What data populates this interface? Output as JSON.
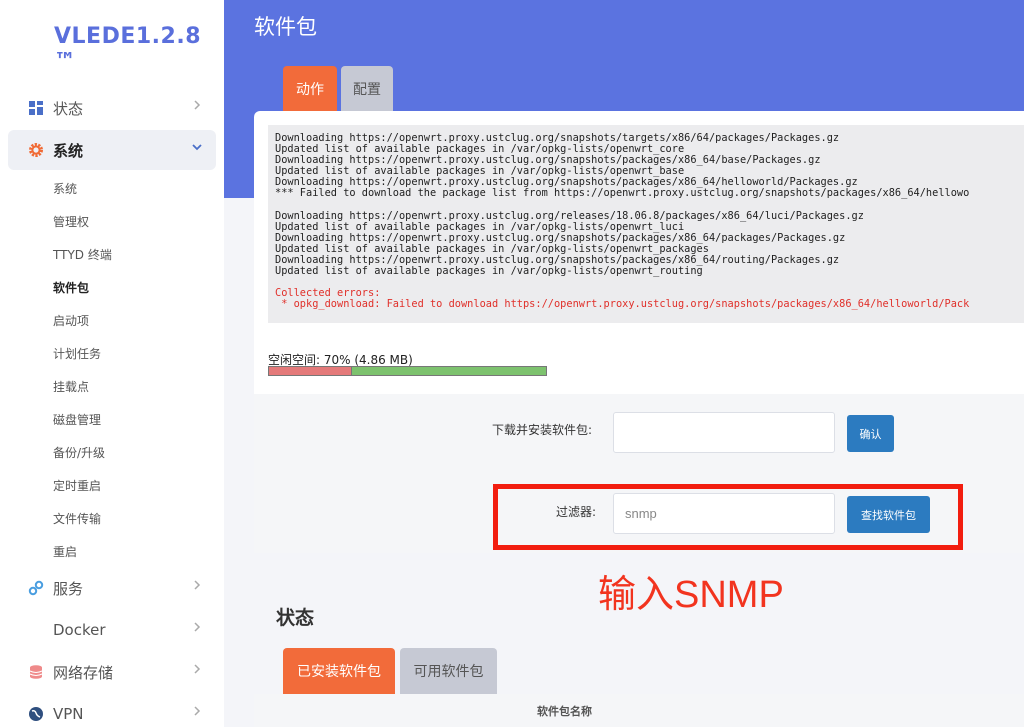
{
  "sidebar": {
    "logo": "VLEDE1.2.8 ™",
    "items": [
      {
        "label": "状态",
        "icon": "dashboard-icon"
      },
      {
        "label": "系统",
        "icon": "gear-icon"
      },
      {
        "label": "服务",
        "icon": "cogs-icon"
      },
      {
        "label": "Docker",
        "icon": ""
      },
      {
        "label": "网络存储",
        "icon": "database-icon"
      },
      {
        "label": "VPN",
        "icon": "globe-icon"
      }
    ],
    "sub_items": [
      "系统",
      "管理权",
      "TTYD 终端",
      "软件包",
      "启动项",
      "计划任务",
      "挂载点",
      "磁盘管理",
      "备份/升级",
      "定时重启",
      "文件传输",
      "重启"
    ]
  },
  "header": {
    "title": "软件包"
  },
  "tabs": {
    "actions": "动作",
    "config": "配置"
  },
  "log": {
    "lines": [
      "Downloading https://openwrt.proxy.ustclug.org/snapshots/targets/x86/64/packages/Packages.gz",
      "Updated list of available packages in /var/opkg-lists/openwrt_core",
      "Downloading https://openwrt.proxy.ustclug.org/snapshots/packages/x86_64/base/Packages.gz",
      "Updated list of available packages in /var/opkg-lists/openwrt_base",
      "Downloading https://openwrt.proxy.ustclug.org/snapshots/packages/x86_64/helloworld/Packages.gz",
      "*** Failed to download the package list from https://openwrt.proxy.ustclug.org/snapshots/packages/x86_64/hellowo",
      "",
      "Downloading https://openwrt.proxy.ustclug.org/releases/18.06.8/packages/x86_64/luci/Packages.gz",
      "Updated list of available packages in /var/opkg-lists/openwrt_luci",
      "Downloading https://openwrt.proxy.ustclug.org/snapshots/packages/x86_64/packages/Packages.gz",
      "Updated list of available packages in /var/opkg-lists/openwrt_packages",
      "Downloading https://openwrt.proxy.ustclug.org/snapshots/packages/x86_64/routing/Packages.gz",
      "Updated list of available packages in /var/opkg-lists/openwrt_routing",
      ""
    ],
    "errors": [
      "Collected errors:",
      " * opkg_download: Failed to download https://openwrt.proxy.ustclug.org/snapshots/packages/x86_64/helloworld/Pack"
    ]
  },
  "disk": {
    "label": "空闲空间: 70% (4.86 MB)",
    "free_fraction": 0.7
  },
  "download": {
    "label": "下载并安装软件包:",
    "value": "",
    "button": "确认"
  },
  "filter": {
    "label": "过滤器:",
    "value": "snmp",
    "button": "查找软件包"
  },
  "annotation": "输入SNMP",
  "status": {
    "title": "状态",
    "tab_installed": "已安装软件包",
    "tab_available": "可用软件包",
    "column_name": "软件包名称"
  },
  "colors": {
    "accent": "#5b73e0",
    "active_tab": "#f26b3a",
    "button": "#2c7bc0",
    "highlight": "#f21d0f"
  }
}
